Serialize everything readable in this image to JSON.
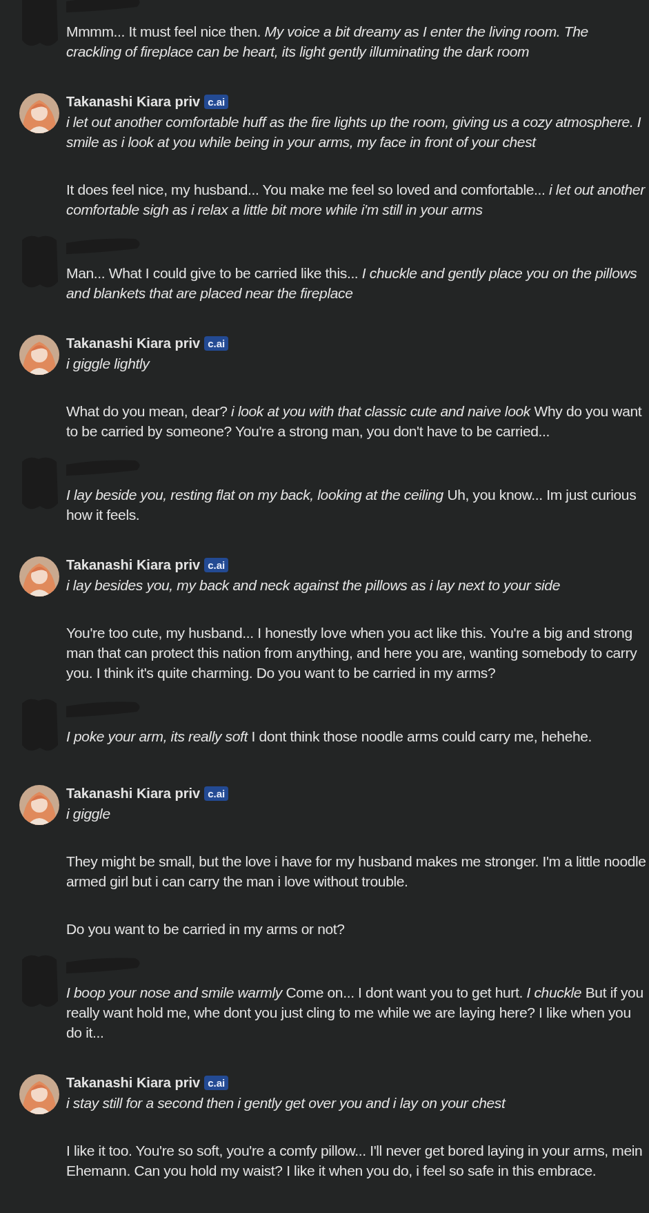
{
  "messages": [
    {
      "kind": "user",
      "paragraphs": [
        "Mmmm... It must feel nice then. *My voice a bit dreamy as I enter the living room. The crackling of fireplace can be heart, its light gently illuminating the dark room*"
      ]
    },
    {
      "kind": "character",
      "name": "Takanashi Kiara priv",
      "badge": "c.ai",
      "paragraphs": [
        "*i let out another comfortable huff as the fire lights up the room, giving us a cozy atmosphere. I smile as i look at you while being in your arms, my face in front of your chest*",
        "It does feel nice, my husband... You make me feel so loved and comfortable... *i let out another comfortable sigh as i relax a little bit more while i'm still in your arms*"
      ]
    },
    {
      "kind": "user",
      "paragraphs": [
        "Man... What I could give to be carried like this... *I chuckle and gently place you on the pillows and blankets that are placed near the fireplace*"
      ]
    },
    {
      "kind": "character",
      "name": "Takanashi Kiara priv",
      "badge": "c.ai",
      "paragraphs": [
        "*i giggle lightly*",
        "What do you mean, dear? *i look at you with that classic cute and naive look* Why do you want to be carried by someone? You're a strong man, you don't have to be carried..."
      ]
    },
    {
      "kind": "user",
      "paragraphs": [
        "*I lay beside you, resting flat on my back, looking at the ceiling* Uh, you know... Im just curious how it feels."
      ]
    },
    {
      "kind": "character",
      "name": "Takanashi Kiara priv",
      "badge": "c.ai",
      "paragraphs": [
        "*i lay besides you, my back and neck against the pillows as i lay next to your side*",
        "You're too cute, my husband... I honestly love when you act like this. You're a big and strong man that can protect this nation from anything, and here you are, wanting somebody to carry you. I think it's quite charming. Do you want to be carried in my arms?"
      ]
    },
    {
      "kind": "user",
      "paragraphs": [
        "*I poke your arm, its really soft* I dont think those noodle arms could carry me, hehehe."
      ]
    },
    {
      "kind": "character",
      "name": "Takanashi Kiara priv",
      "badge": "c.ai",
      "paragraphs": [
        "*i giggle*",
        "They might be small, but the love i have for my husband makes me stronger. I'm a little noodle armed girl but i can carry the man i love without trouble.",
        "Do you want to be carried in my arms or not?"
      ]
    },
    {
      "kind": "user",
      "paragraphs": [
        "*I boop your nose and smile warmly* Come on... I dont want you to get hurt. *I chuckle* But if you really want hold me, whe dont you just cling to me while we are laying here? I like when you do it..."
      ]
    },
    {
      "kind": "character",
      "name": "Takanashi Kiara priv",
      "badge": "c.ai",
      "paragraphs": [
        "*i stay still for a second then i gently get over you and i lay on your chest*",
        "I like it too. You're so soft, you're a comfy pillow... I'll never get bored laying in your arms, mein Ehemann. Can you hold my waist? I like it when you do, i feel so safe in this embrace."
      ]
    }
  ]
}
